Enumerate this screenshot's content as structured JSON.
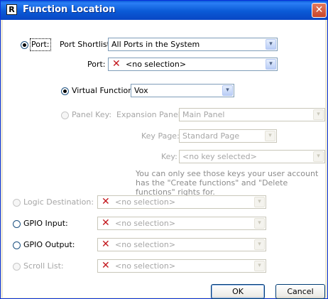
{
  "window": {
    "title": "Function Location",
    "logo_letter": "R",
    "close_glyph": "✕"
  },
  "port": {
    "radio_label": "Port:",
    "shortlist_label": "Port Shortlist:",
    "shortlist_value": "All Ports in the System",
    "port_label": "Port:",
    "port_value": "<no selection>"
  },
  "virtual_function": {
    "label": "Virtual Function:",
    "value": "Vox"
  },
  "panel_key": {
    "label": "Panel Key:",
    "expansion_label": "Expansion Panel:",
    "expansion_value": "Main Panel",
    "key_page_label": "Key Page:",
    "key_page_value": "Standard Page",
    "key_label": "Key:",
    "key_value": "<no key selected>",
    "note": "You can only see those keys your user account has the \"Create functions\" and \"Delete functions\" rights for."
  },
  "rows": [
    {
      "label": "Logic Destination:",
      "value": "<no selection>"
    },
    {
      "label": "GPIO Input:",
      "value": "<no selection>"
    },
    {
      "label": "GPIO Output:",
      "value": "<no selection>"
    },
    {
      "label": "Scroll List:",
      "value": "<no selection>"
    }
  ],
  "buttons": {
    "ok": "OK",
    "cancel": "Cancel"
  },
  "icons": {
    "x_mark": "✕",
    "dropdown_arrow": "▾"
  },
  "colors": {
    "title_bar": "#0a5ad6",
    "x_mark": "#c2151b",
    "disabled_text": "#a6a6a6"
  }
}
